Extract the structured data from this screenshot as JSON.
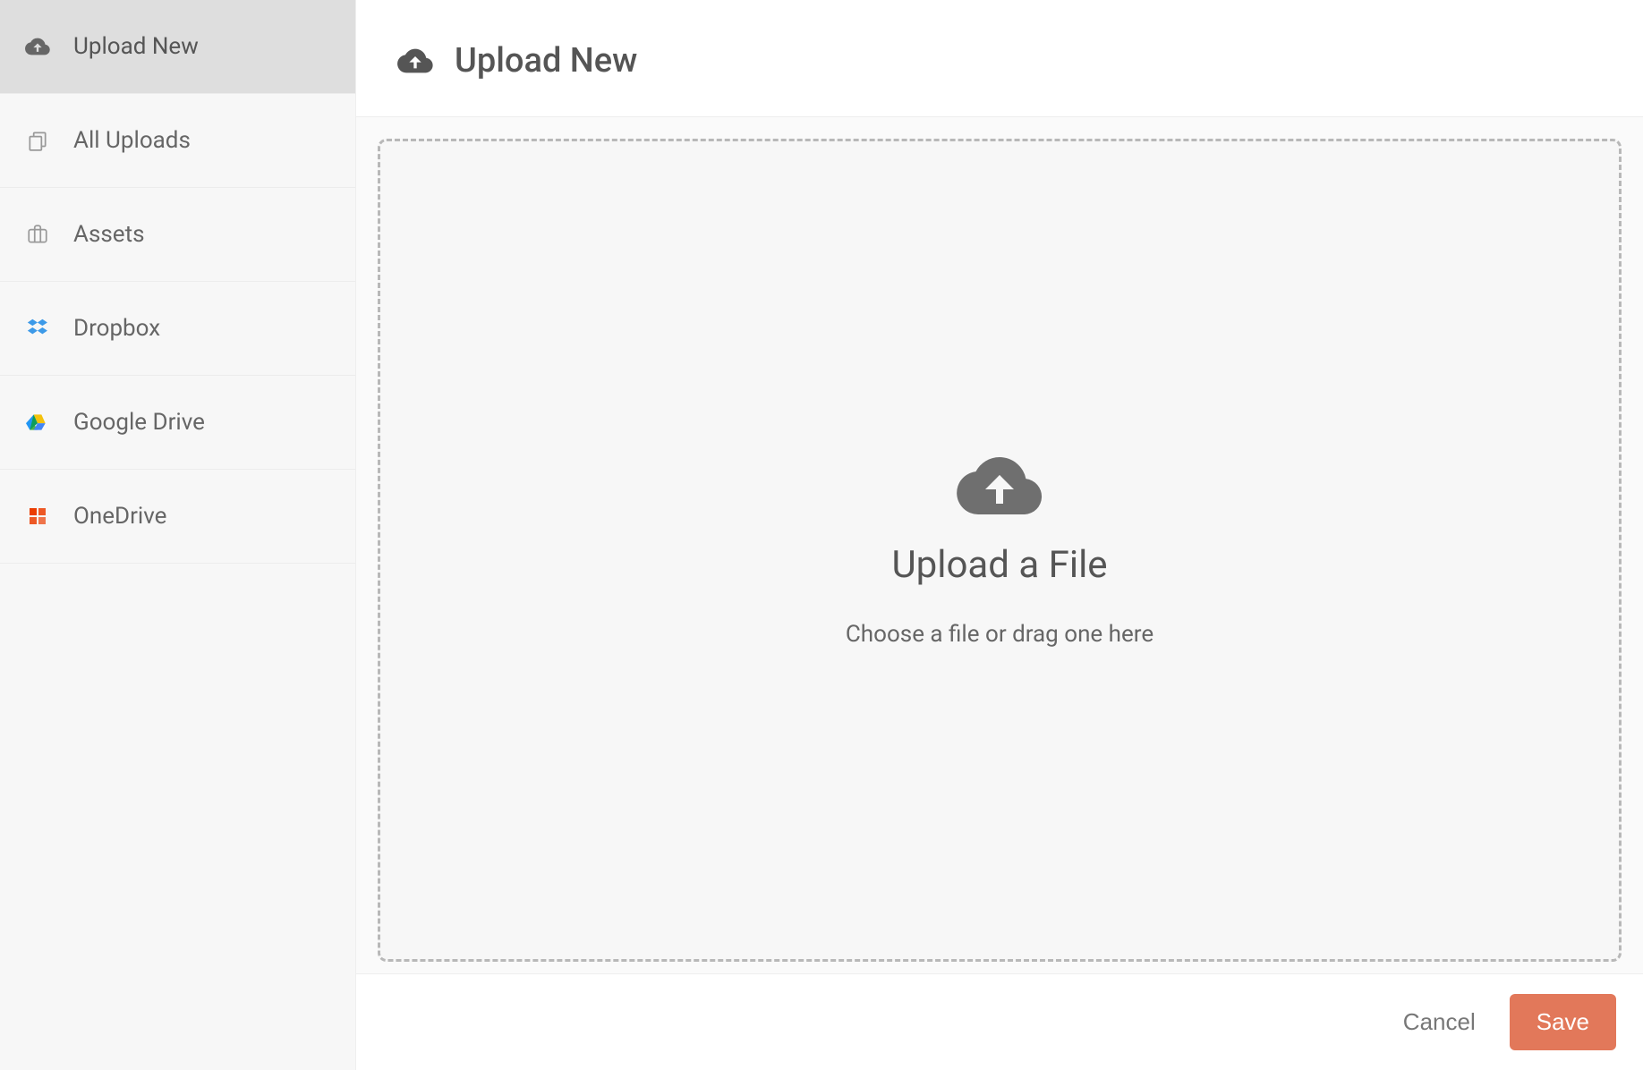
{
  "sidebar": {
    "items": [
      {
        "label": "Upload New"
      },
      {
        "label": "All Uploads"
      },
      {
        "label": "Assets"
      },
      {
        "label": "Dropbox"
      },
      {
        "label": "Google Drive"
      },
      {
        "label": "OneDrive"
      }
    ]
  },
  "header": {
    "title": "Upload New"
  },
  "dropzone": {
    "title": "Upload a File",
    "subtitle": "Choose a file or drag one here"
  },
  "footer": {
    "cancel_label": "Cancel",
    "save_label": "Save"
  }
}
